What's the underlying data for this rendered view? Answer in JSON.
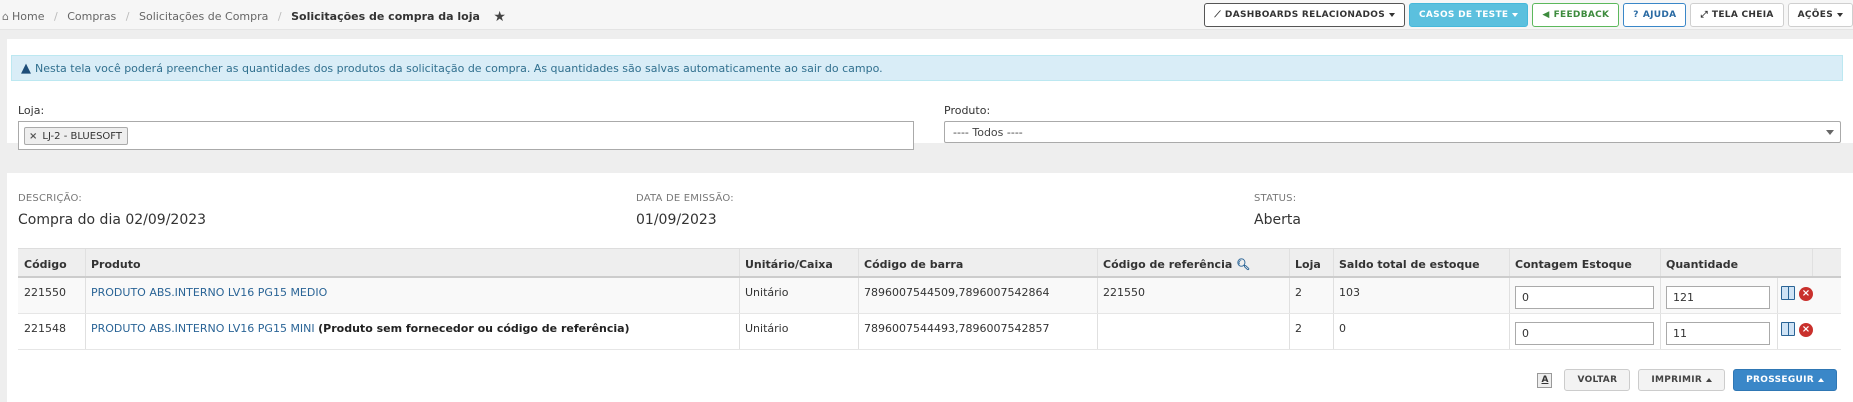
{
  "breadcrumb": {
    "items": [
      "Home",
      "Compras",
      "Solicitações de Compra"
    ],
    "current": "Solicitações de compra da loja"
  },
  "toolbar": {
    "dashboards": "DASHBOARDS RELACIONADOS",
    "casos_teste": "CASOS DE TESTE",
    "feedback": "FEEDBACK",
    "ajuda": "AJUDA",
    "tela_cheia": "TELA CHEIA",
    "acoes": "AÇÕES"
  },
  "alert": {
    "text": "Nesta tela você poderá preencher as quantidades dos produtos da solicitação de compra. As quantidades são salvas automaticamente ao sair do campo."
  },
  "filters": {
    "loja_label": "Loja:",
    "loja_tag": "LJ-2 - BLUESOFT",
    "produto_label": "Produto:",
    "produto_value": "---- Todos ----"
  },
  "info": {
    "descricao_label": "DESCRIÇÃO:",
    "descricao_value": "Compra do dia 02/09/2023",
    "emissao_label": "DATA DE EMISSÃO:",
    "emissao_value": "01/09/2023",
    "status_label": "STATUS:",
    "status_value": "Aberta"
  },
  "table": {
    "headers": [
      "Código",
      "Produto",
      "Unitário/Caixa",
      "Código de barra",
      "Código de referência",
      "Loja",
      "Saldo total de estoque",
      "Contagem Estoque",
      "Quantidade"
    ],
    "rows": [
      {
        "codigo": "221550",
        "produto": "PRODUTO ABS.INTERNO LV16 PG15 MEDIO",
        "note": "",
        "unitario": "Unitário",
        "barra": "7896007544509,7896007542864",
        "referencia": "221550",
        "loja": "2",
        "saldo": "103",
        "contagem": "0",
        "quantidade": "121"
      },
      {
        "codigo": "221548",
        "produto": "PRODUTO ABS.INTERNO LV16 PG15 MINI",
        "note": "(Produto sem fornecedor ou código de referência)",
        "unitario": "Unitário",
        "barra": "7896007544493,7896007542857",
        "referencia": "",
        "loja": "2",
        "saldo": "0",
        "contagem": "0",
        "quantidade": "11"
      }
    ]
  },
  "footer": {
    "font_glyph": "A",
    "voltar": "VOLTAR",
    "imprimir": "IMPRIMIR",
    "prosseguir": "PROSSEGUIR"
  }
}
